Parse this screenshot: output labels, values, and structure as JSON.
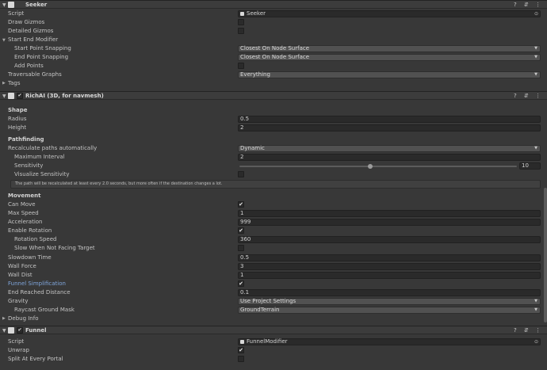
{
  "seeker": {
    "title": "Seeker",
    "script_label": "Script",
    "script_value": "Seeker",
    "draw_gizmos": "Draw Gizmos",
    "detailed_gizmos": "Detailed Gizmos",
    "start_end_modifier": "Start End Modifier",
    "start_point_snapping": "Start Point Snapping",
    "start_point_value": "Closest On Node Surface",
    "end_point_snapping": "End Point Snapping",
    "end_point_value": "Closest On Node Surface",
    "add_points": "Add Points",
    "traversable_graphs": "Traversable Graphs",
    "traversable_value": "Everything",
    "tags": "Tags"
  },
  "richai": {
    "title": "RichAI (3D, for navmesh)",
    "shape_header": "Shape",
    "radius_label": "Radius",
    "radius_value": "0.5",
    "height_label": "Height",
    "height_value": "2",
    "pathfinding_header": "Pathfinding",
    "recalc_label": "Recalculate paths automatically",
    "recalc_value": "Dynamic",
    "max_interval_label": "Maximum Interval",
    "max_interval_value": "2",
    "sensitivity_label": "Sensitivity",
    "sensitivity_value": "10",
    "sensitivity_fraction": 0.47,
    "visualize_label": "Visualize Sensitivity",
    "help_text": "The path will be recalculated at least every 2.0 seconds, but more often if the destination changes a lot.",
    "movement_header": "Movement",
    "can_move_label": "Can Move",
    "max_speed_label": "Max Speed",
    "max_speed_value": "1",
    "acceleration_label": "Acceleration",
    "acceleration_value": "999",
    "enable_rotation_label": "Enable Rotation",
    "rotation_speed_label": "Rotation Speed",
    "rotation_speed_value": "360",
    "slow_facing_label": "Slow When Not Facing Target",
    "slowdown_time_label": "Slowdown Time",
    "slowdown_time_value": "0.5",
    "wall_force_label": "Wall Force",
    "wall_force_value": "3",
    "wall_dist_label": "Wall Dist",
    "wall_dist_value": "1",
    "funnel_simpl_label": "Funnel Simplification",
    "end_reached_label": "End Reached Distance",
    "end_reached_value": "0.1",
    "gravity_label": "Gravity",
    "gravity_value": "Use Project Settings",
    "raycast_label": "Raycast Ground Mask",
    "raycast_value": "GroundTerrain",
    "debug_info": "Debug Info"
  },
  "funnel": {
    "title": "Funnel",
    "script_label": "Script",
    "script_value": "FunnelModifier",
    "unwrap_label": "Unwrap",
    "split_label": "Split At Every Portal"
  },
  "glyphs": {
    "check": "✔",
    "fold": "▼",
    "tri": "▶",
    "arrow": "▼",
    "help": "?",
    "settings": "⇵",
    "more": "⋮",
    "target": "⊙"
  },
  "colors": {
    "background": "#383838",
    "field": "#2a2a2a",
    "dropdown": "#515151",
    "highlight_label": "#7fa5db"
  }
}
